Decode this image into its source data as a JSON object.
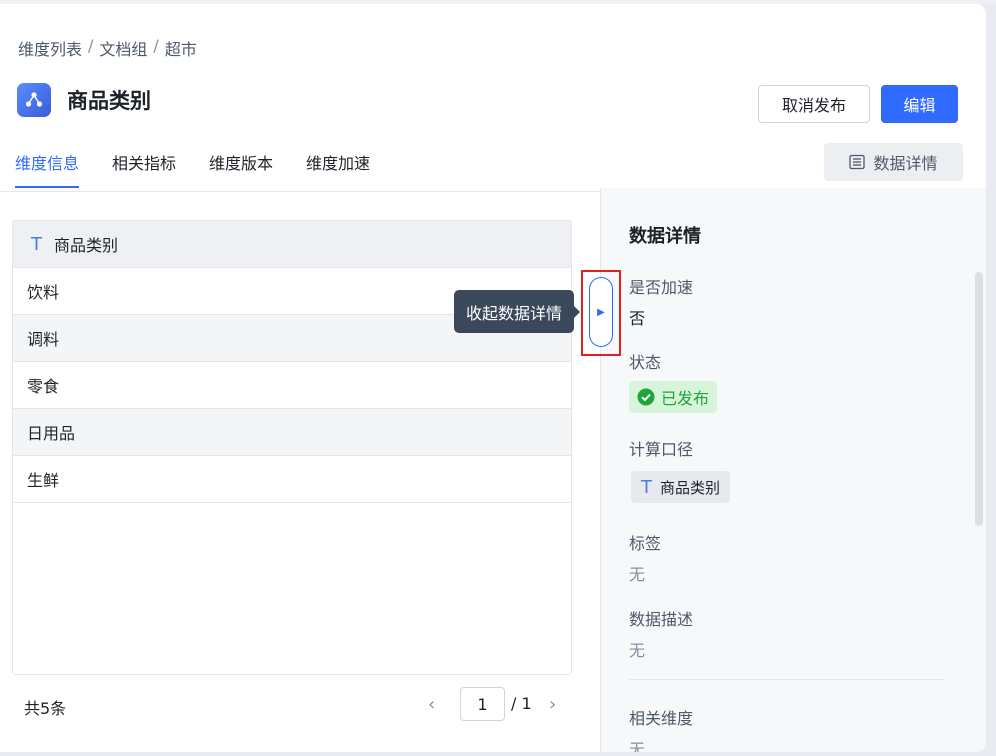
{
  "breadcrumb": {
    "items": [
      "维度列表",
      "文档组",
      "超市"
    ],
    "separator": "/"
  },
  "header": {
    "title": "商品类别",
    "cancel_publish": "取消发布",
    "edit": "编辑"
  },
  "tabs": [
    "维度信息",
    "相关指标",
    "维度版本",
    "维度加速"
  ],
  "active_tab": "维度信息",
  "data_detail_button": "数据详情",
  "table": {
    "column": "商品类别",
    "rows": [
      "饮料",
      "调料",
      "零食",
      "日用品",
      "生鲜"
    ]
  },
  "pager": {
    "total": "共5条",
    "page": "1",
    "page_total": "/ 1"
  },
  "tooltip": "收起数据详情",
  "panel": {
    "title": "数据详情",
    "accelerate_label": "是否加速",
    "accelerate_value": "否",
    "status_label": "状态",
    "status_value": "已发布",
    "formula_label": "计算口径",
    "formula_value": "商品类别",
    "tags_label": "标签",
    "tags_value": "无",
    "desc_label": "数据描述",
    "desc_value": "无",
    "related_label": "相关维度",
    "related_value": "无"
  },
  "colors": {
    "accent": "#2f6bff",
    "success": "#23a43a",
    "highlight": "#e02020"
  }
}
